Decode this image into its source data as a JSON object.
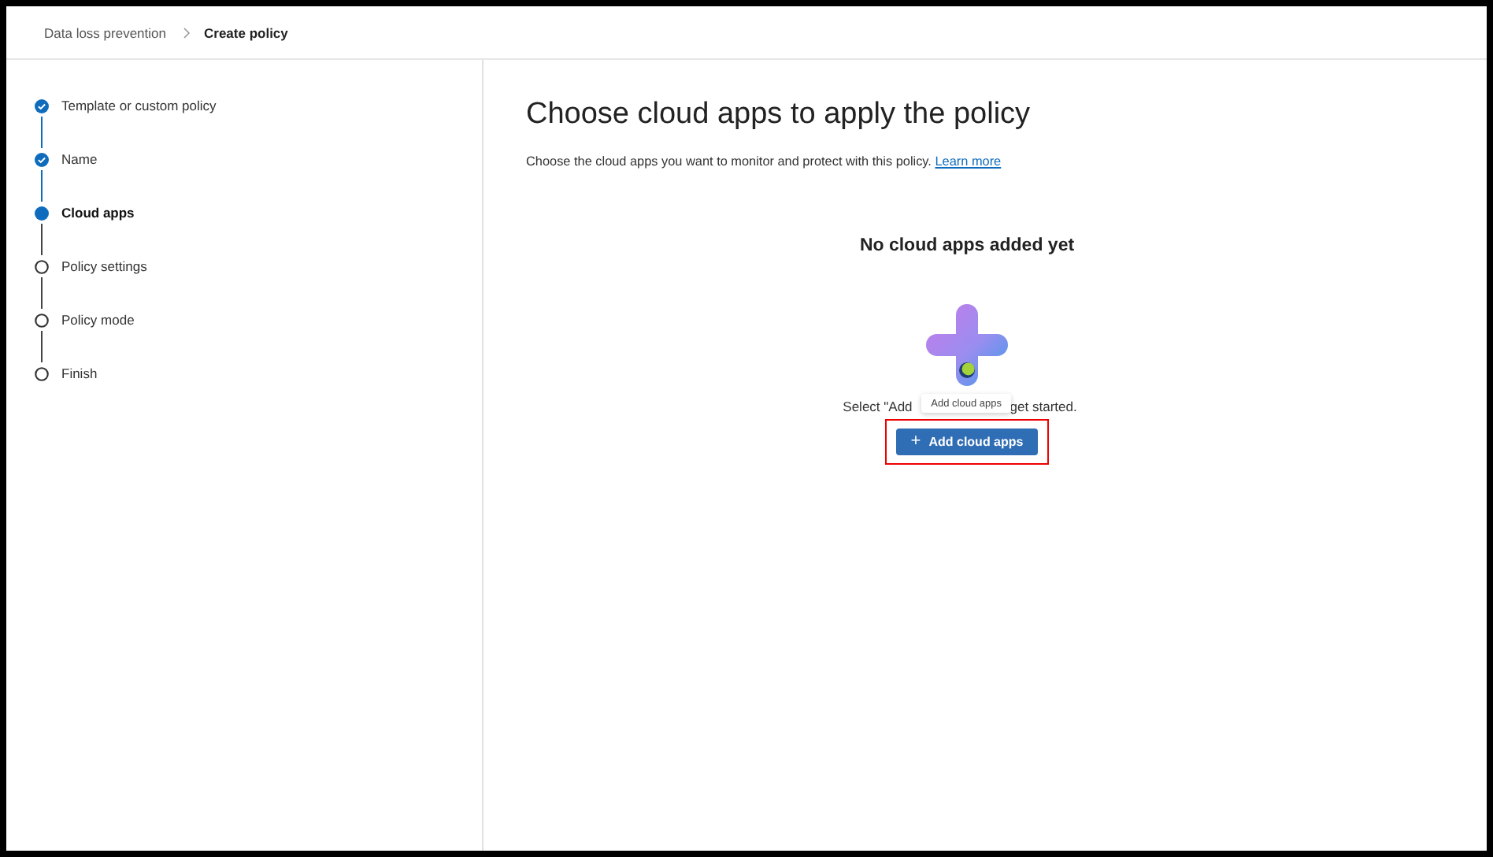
{
  "breadcrumb": [
    {
      "label": "Data loss prevention",
      "current": false
    },
    {
      "label": "Create policy",
      "current": true
    }
  ],
  "steps": [
    {
      "label": "Template or custom policy",
      "kind": "done"
    },
    {
      "label": "Name",
      "kind": "done"
    },
    {
      "label": "Cloud apps",
      "kind": "current"
    },
    {
      "label": "Policy settings",
      "kind": "todo"
    },
    {
      "label": "Policy mode",
      "kind": "todo"
    },
    {
      "label": "Finish",
      "kind": "todo"
    }
  ],
  "main": {
    "title": "Choose cloud apps to apply the policy",
    "description": "Choose the cloud apps you want to monitor and protect with this policy.",
    "link": "Learn more",
    "empty_state": {
      "heading": "No cloud apps added yet",
      "hint_start": "Select \"Add",
      "hint_end": "get started.",
      "tooltip": "Add cloud apps",
      "button": {
        "icon": "+",
        "label": "Add cloud apps",
        "highlighted": true
      }
    }
  }
}
